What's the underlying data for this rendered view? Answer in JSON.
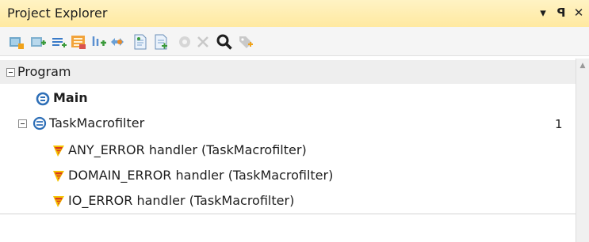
{
  "panel": {
    "title": "Project Explorer",
    "dropdown_glyph": "▾",
    "pin_glyph": "ꟼ",
    "close_glyph": "✕"
  },
  "toolbar": {
    "icons": [
      "add-task-icon",
      "add-item-icon",
      "list-icon",
      "properties-icon",
      "sort-icon",
      "move-icon",
      "document-icon",
      "document-add-icon",
      "disabled-gear-icon",
      "disabled-delete-icon",
      "search-icon",
      "tag-icon"
    ]
  },
  "tree": {
    "program_label": "Program",
    "main_label": "Main",
    "task_label": "TaskMacrofilter",
    "task_count": "1",
    "handlers": [
      "ANY_ERROR handler (TaskMacrofilter)",
      "DOMAIN_ERROR handler (TaskMacrofilter)",
      "IO_ERROR handler (TaskMacrofilter)"
    ]
  },
  "colors": {
    "title_bar": "#ffe9a0",
    "icon_blue": "#2e6fb7",
    "handler_red": "#d83b1f",
    "handler_yellow": "#f5c400"
  }
}
